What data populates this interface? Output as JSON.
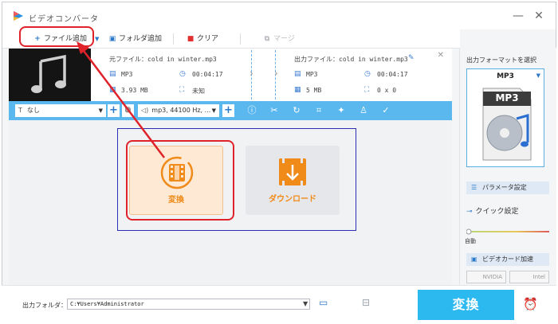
{
  "window": {
    "title": "ビデオコンバータ",
    "minimize_glyph": "—",
    "close_glyph": "✕"
  },
  "toolbar": {
    "add_file": "ファイル追加",
    "add_folder": "フォルダ追加",
    "clear": "クリア",
    "merge": "マージ"
  },
  "file": {
    "source_label": "元ファイル：",
    "source_name": "cold in winter.mp3",
    "source_format": "MP3",
    "source_duration": "00:04:17",
    "source_size": "3.93 MB",
    "source_resolution": "未知",
    "output_label": "出力ファイル：",
    "output_name": "cold in winter.mp3",
    "output_format": "MP3",
    "output_duration": "00:04:17",
    "output_size": "5 MB",
    "output_resolution": "0 x 0"
  },
  "edit_bar": {
    "subtitle_value": "なし",
    "audio_value": "mp3, 44100 Hz, ..."
  },
  "cards": {
    "convert_label": "変換",
    "download_label": "ダウンロード"
  },
  "right_panel": {
    "output_format_title": "出力フォーマットを選択",
    "selected_format": "MP3",
    "format_badge": "MP3",
    "param_settings": "パラメータ設定",
    "quick_settings": "クイック設定",
    "auto_label": "自動",
    "gpu_accel": "ビデオカード加速",
    "nvidia": "NVIDIA",
    "intel": "Intel"
  },
  "bottom": {
    "output_folder_label": "出力フォルダ：",
    "output_folder_path": "C:¥Users¥Administrator",
    "convert_button": "変換"
  },
  "colors": {
    "accent_blue": "#5bb8ee",
    "convert_blue": "#2bb9f0",
    "orange": "#f08a18",
    "highlight_red": "#e0232b",
    "panel_navy": "#2b2fb3"
  }
}
